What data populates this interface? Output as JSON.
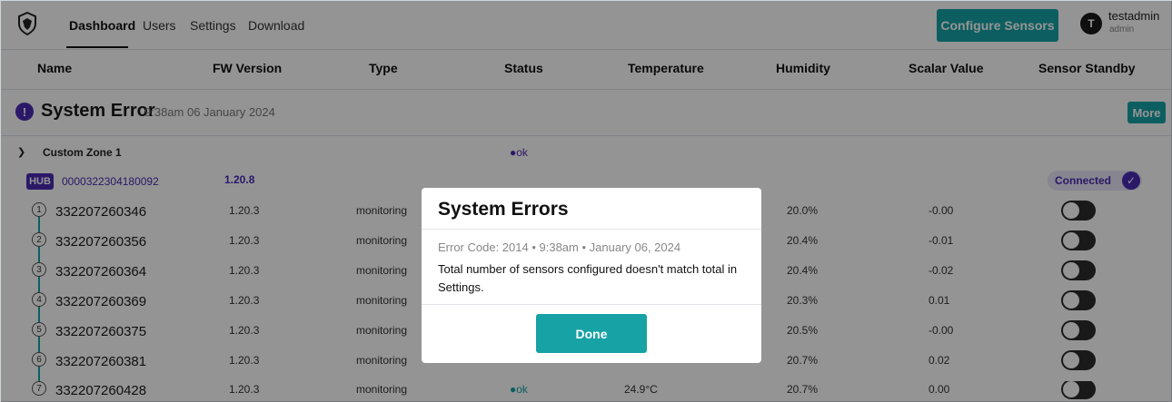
{
  "nav": {
    "tabs": [
      "Dashboard",
      "Users",
      "Settings",
      "Download"
    ],
    "active_tab": "Dashboard",
    "configure_label": "Configure Sensors",
    "user": {
      "initial": "T",
      "name": "testadmin",
      "role": "admin"
    }
  },
  "columns": [
    "Name",
    "FW Version",
    "Type",
    "Status",
    "Temperature",
    "Humidity",
    "Scalar Value",
    "Sensor Standby"
  ],
  "system_error": {
    "icon": "!",
    "title": "System Error",
    "time": "9:38am 06 January 2024",
    "more_label": "More"
  },
  "zone": {
    "name": "Custom Zone 1",
    "status": "●ok"
  },
  "hub": {
    "badge": "HUB",
    "id": "0000322304180092",
    "fw": "1.20.8",
    "connection": "Connected"
  },
  "sensors": [
    {
      "num": "1",
      "id": "332207260346",
      "fw": "1.20.3",
      "type": "monitoring",
      "status": "",
      "temp": "",
      "humidity": "20.0%",
      "scalar": "-0.00",
      "standby": false
    },
    {
      "num": "2",
      "id": "332207260356",
      "fw": "1.20.3",
      "type": "monitoring",
      "status": "",
      "temp": "",
      "humidity": "20.4%",
      "scalar": "-0.01",
      "standby": false
    },
    {
      "num": "3",
      "id": "332207260364",
      "fw": "1.20.3",
      "type": "monitoring",
      "status": "",
      "temp": "",
      "humidity": "20.4%",
      "scalar": "-0.02",
      "standby": false
    },
    {
      "num": "4",
      "id": "332207260369",
      "fw": "1.20.3",
      "type": "monitoring",
      "status": "",
      "temp": "",
      "humidity": "20.3%",
      "scalar": "0.01",
      "standby": false
    },
    {
      "num": "5",
      "id": "332207260375",
      "fw": "1.20.3",
      "type": "monitoring",
      "status": "",
      "temp": "",
      "humidity": "20.5%",
      "scalar": "-0.00",
      "standby": false
    },
    {
      "num": "6",
      "id": "332207260381",
      "fw": "1.20.3",
      "type": "monitoring",
      "status": "",
      "temp": "",
      "humidity": "20.7%",
      "scalar": "0.02",
      "standby": false
    },
    {
      "num": "7",
      "id": "332207260428",
      "fw": "1.20.3",
      "type": "monitoring",
      "status": "●ok",
      "temp": "24.9°C",
      "humidity": "20.7%",
      "scalar": "0.00",
      "standby": false
    }
  ],
  "modal": {
    "title": "System Errors",
    "meta": "Error Code: 2014 • 9:38am • January 06, 2024",
    "message": "Total number of sensors configured doesn't match total in Settings.",
    "done_label": "Done"
  },
  "colors": {
    "accent": "#17a2a5",
    "purple": "#4a2bb3"
  }
}
